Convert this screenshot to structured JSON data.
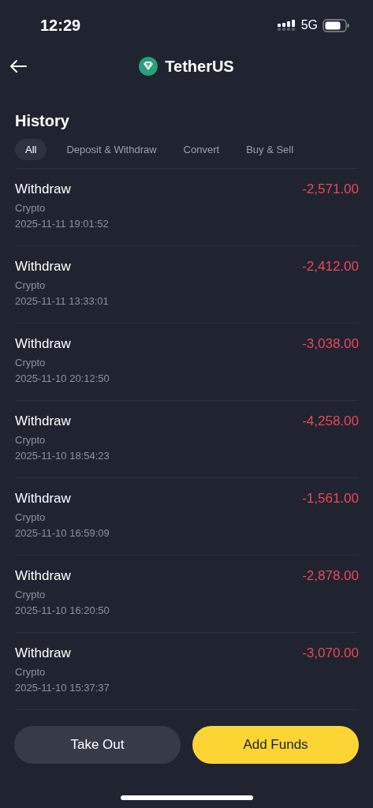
{
  "status_bar": {
    "time": "12:29",
    "network": "5G"
  },
  "header": {
    "title": "TetherUS"
  },
  "history": {
    "title": "History",
    "tabs": [
      {
        "label": "All",
        "selected": true
      },
      {
        "label": "Deposit & Withdraw",
        "selected": false
      },
      {
        "label": "Convert",
        "selected": false
      },
      {
        "label": "Buy & Sell",
        "selected": false
      }
    ],
    "rows": [
      {
        "type": "Withdraw",
        "method": "Crypto",
        "time": "2025-11-11 19:01:52",
        "amount": "-2,571.00"
      },
      {
        "type": "Withdraw",
        "method": "Crypto",
        "time": "2025-11-11 13:33:01",
        "amount": "-2,412.00"
      },
      {
        "type": "Withdraw",
        "method": "Crypto",
        "time": "2025-11-10 20:12:50",
        "amount": "-3,038.00"
      },
      {
        "type": "Withdraw",
        "method": "Crypto",
        "time": "2025-11-10 18:54:23",
        "amount": "-4,258.00"
      },
      {
        "type": "Withdraw",
        "method": "Crypto",
        "time": "2025-11-10 16:59:09",
        "amount": "-1,561.00"
      },
      {
        "type": "Withdraw",
        "method": "Crypto",
        "time": "2025-11-10 16:20:50",
        "amount": "-2,878.00"
      },
      {
        "type": "Withdraw",
        "method": "Crypto",
        "time": "2025-11-10 15:37:37",
        "amount": "-3,070.00"
      }
    ]
  },
  "buttons": [
    {
      "label": "Take Out",
      "kind": "secondary"
    },
    {
      "label": "Add Funds",
      "kind": "primary"
    }
  ]
}
